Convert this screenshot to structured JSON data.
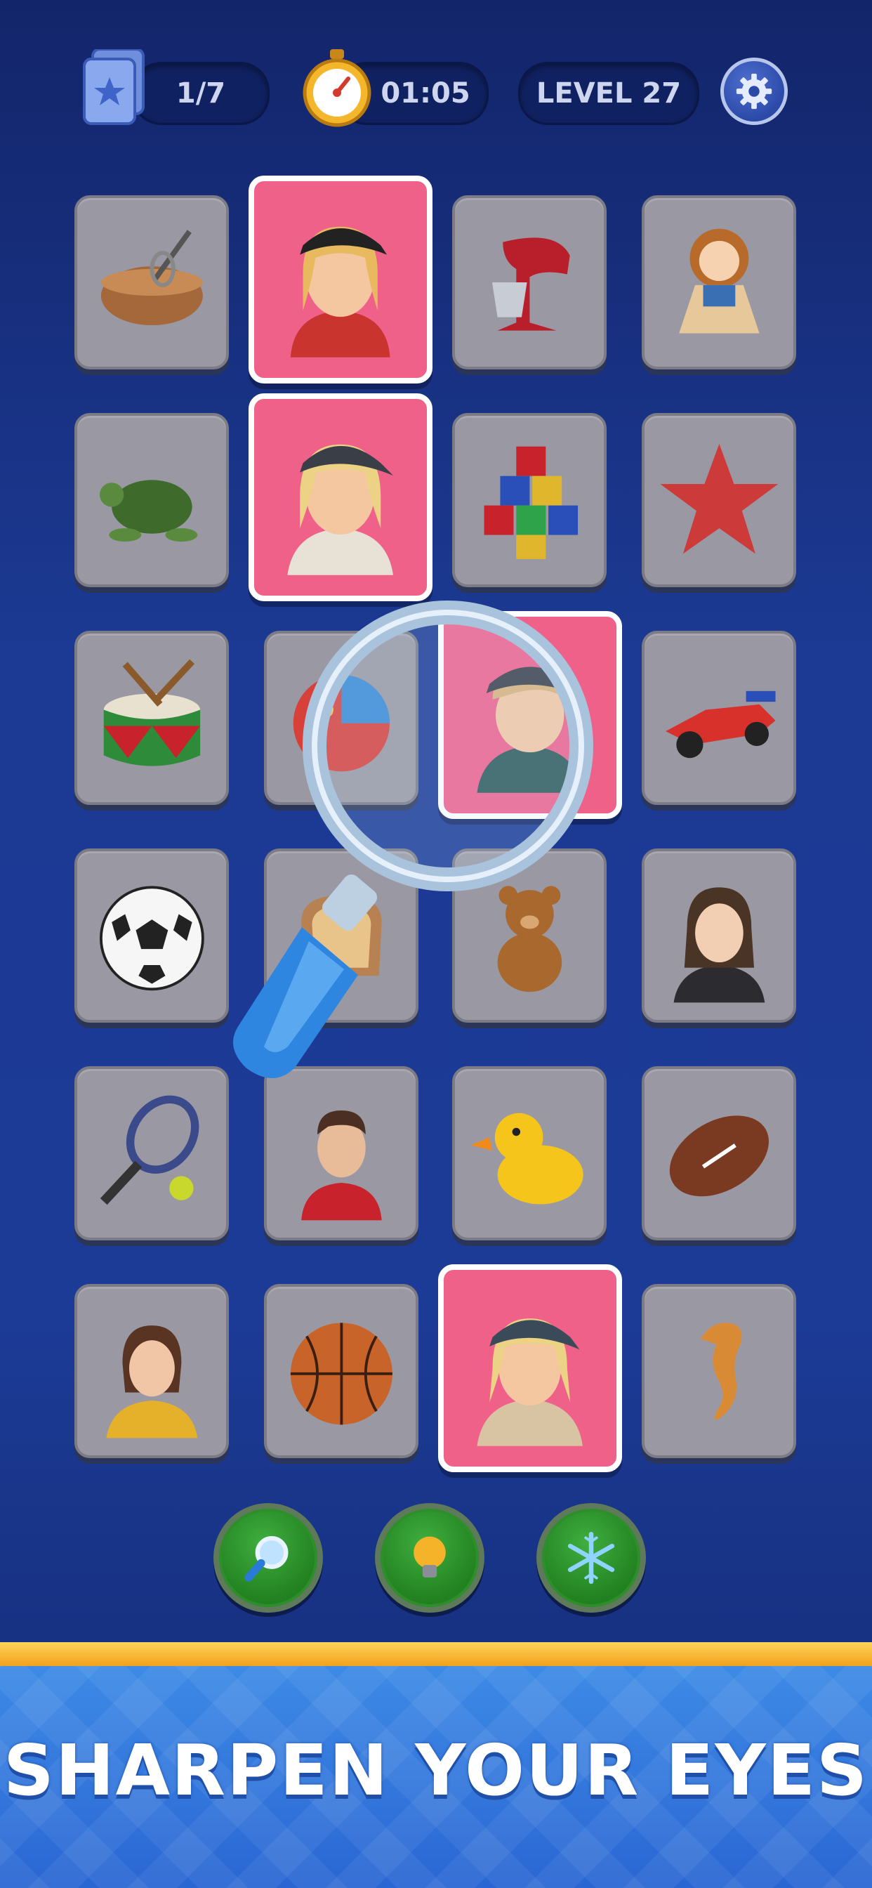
{
  "hud": {
    "cards_progress": "1/7",
    "timer": "01:05",
    "level": "LEVEL 27",
    "icons": {
      "cards": "card-stack-icon",
      "timer": "stopwatch-icon",
      "settings": "gear-icon"
    }
  },
  "board": {
    "tiles": [
      {
        "item": "mixing bowl",
        "state": "hidden"
      },
      {
        "item": "girl red hoodie",
        "state": "revealed"
      },
      {
        "item": "stand mixer",
        "state": "hidden"
      },
      {
        "item": "rag doll",
        "state": "hidden"
      },
      {
        "item": "sea turtle",
        "state": "hidden"
      },
      {
        "item": "girl cap jacket",
        "state": "revealed"
      },
      {
        "item": "toy blocks",
        "state": "hidden"
      },
      {
        "item": "starfish",
        "state": "hidden"
      },
      {
        "item": "drum",
        "state": "hidden"
      },
      {
        "item": "ball",
        "state": "hidden"
      },
      {
        "item": "boy cap hoodie",
        "state": "revealed"
      },
      {
        "item": "race car",
        "state": "hidden"
      },
      {
        "item": "soccer ball",
        "state": "hidden"
      },
      {
        "item": "toast",
        "state": "hidden"
      },
      {
        "item": "teddy bear",
        "state": "hidden"
      },
      {
        "item": "woman blazer",
        "state": "hidden"
      },
      {
        "item": "tennis racket",
        "state": "hidden"
      },
      {
        "item": "basketball player",
        "state": "hidden"
      },
      {
        "item": "rubber duck",
        "state": "hidden"
      },
      {
        "item": "american football",
        "state": "hidden"
      },
      {
        "item": "girl yellow jacket",
        "state": "hidden"
      },
      {
        "item": "basketball",
        "state": "hidden"
      },
      {
        "item": "girl cap beige hoodie",
        "state": "revealed"
      },
      {
        "item": "seahorse",
        "state": "hidden"
      }
    ]
  },
  "boosters": [
    {
      "name": "magnifier",
      "icon": "magnifier-icon"
    },
    {
      "name": "hint",
      "icon": "lightbulb-icon"
    },
    {
      "name": "freeze",
      "icon": "snowflake-icon"
    }
  ],
  "banner": {
    "text": "SHARPEN YOUR EYES"
  },
  "colors": {
    "background": "#1c3a94",
    "tile": "#9a99a3",
    "revealed_tile": "#f0618a",
    "banner": "#3f8ee8",
    "booster": "#2f9a2e"
  }
}
